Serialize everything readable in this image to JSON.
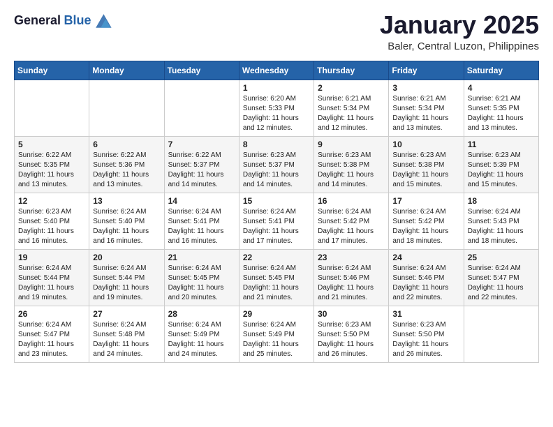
{
  "logo": {
    "line1": "General",
    "line2": "Blue"
  },
  "title": "January 2025",
  "location": "Baler, Central Luzon, Philippines",
  "weekdays": [
    "Sunday",
    "Monday",
    "Tuesday",
    "Wednesday",
    "Thursday",
    "Friday",
    "Saturday"
  ],
  "weeks": [
    [
      {
        "day": "",
        "text": ""
      },
      {
        "day": "",
        "text": ""
      },
      {
        "day": "",
        "text": ""
      },
      {
        "day": "1",
        "sunrise": "6:20 AM",
        "sunset": "5:33 PM",
        "daylight": "11 hours and 12 minutes."
      },
      {
        "day": "2",
        "sunrise": "6:21 AM",
        "sunset": "5:34 PM",
        "daylight": "11 hours and 12 minutes."
      },
      {
        "day": "3",
        "sunrise": "6:21 AM",
        "sunset": "5:34 PM",
        "daylight": "11 hours and 13 minutes."
      },
      {
        "day": "4",
        "sunrise": "6:21 AM",
        "sunset": "5:35 PM",
        "daylight": "11 hours and 13 minutes."
      }
    ],
    [
      {
        "day": "5",
        "sunrise": "6:22 AM",
        "sunset": "5:35 PM",
        "daylight": "11 hours and 13 minutes."
      },
      {
        "day": "6",
        "sunrise": "6:22 AM",
        "sunset": "5:36 PM",
        "daylight": "11 hours and 13 minutes."
      },
      {
        "day": "7",
        "sunrise": "6:22 AM",
        "sunset": "5:37 PM",
        "daylight": "11 hours and 14 minutes."
      },
      {
        "day": "8",
        "sunrise": "6:23 AM",
        "sunset": "5:37 PM",
        "daylight": "11 hours and 14 minutes."
      },
      {
        "day": "9",
        "sunrise": "6:23 AM",
        "sunset": "5:38 PM",
        "daylight": "11 hours and 14 minutes."
      },
      {
        "day": "10",
        "sunrise": "6:23 AM",
        "sunset": "5:38 PM",
        "daylight": "11 hours and 15 minutes."
      },
      {
        "day": "11",
        "sunrise": "6:23 AM",
        "sunset": "5:39 PM",
        "daylight": "11 hours and 15 minutes."
      }
    ],
    [
      {
        "day": "12",
        "sunrise": "6:23 AM",
        "sunset": "5:40 PM",
        "daylight": "11 hours and 16 minutes."
      },
      {
        "day": "13",
        "sunrise": "6:24 AM",
        "sunset": "5:40 PM",
        "daylight": "11 hours and 16 minutes."
      },
      {
        "day": "14",
        "sunrise": "6:24 AM",
        "sunset": "5:41 PM",
        "daylight": "11 hours and 16 minutes."
      },
      {
        "day": "15",
        "sunrise": "6:24 AM",
        "sunset": "5:41 PM",
        "daylight": "11 hours and 17 minutes."
      },
      {
        "day": "16",
        "sunrise": "6:24 AM",
        "sunset": "5:42 PM",
        "daylight": "11 hours and 17 minutes."
      },
      {
        "day": "17",
        "sunrise": "6:24 AM",
        "sunset": "5:42 PM",
        "daylight": "11 hours and 18 minutes."
      },
      {
        "day": "18",
        "sunrise": "6:24 AM",
        "sunset": "5:43 PM",
        "daylight": "11 hours and 18 minutes."
      }
    ],
    [
      {
        "day": "19",
        "sunrise": "6:24 AM",
        "sunset": "5:44 PM",
        "daylight": "11 hours and 19 minutes."
      },
      {
        "day": "20",
        "sunrise": "6:24 AM",
        "sunset": "5:44 PM",
        "daylight": "11 hours and 19 minutes."
      },
      {
        "day": "21",
        "sunrise": "6:24 AM",
        "sunset": "5:45 PM",
        "daylight": "11 hours and 20 minutes."
      },
      {
        "day": "22",
        "sunrise": "6:24 AM",
        "sunset": "5:45 PM",
        "daylight": "11 hours and 21 minutes."
      },
      {
        "day": "23",
        "sunrise": "6:24 AM",
        "sunset": "5:46 PM",
        "daylight": "11 hours and 21 minutes."
      },
      {
        "day": "24",
        "sunrise": "6:24 AM",
        "sunset": "5:46 PM",
        "daylight": "11 hours and 22 minutes."
      },
      {
        "day": "25",
        "sunrise": "6:24 AM",
        "sunset": "5:47 PM",
        "daylight": "11 hours and 22 minutes."
      }
    ],
    [
      {
        "day": "26",
        "sunrise": "6:24 AM",
        "sunset": "5:47 PM",
        "daylight": "11 hours and 23 minutes."
      },
      {
        "day": "27",
        "sunrise": "6:24 AM",
        "sunset": "5:48 PM",
        "daylight": "11 hours and 24 minutes."
      },
      {
        "day": "28",
        "sunrise": "6:24 AM",
        "sunset": "5:49 PM",
        "daylight": "11 hours and 24 minutes."
      },
      {
        "day": "29",
        "sunrise": "6:24 AM",
        "sunset": "5:49 PM",
        "daylight": "11 hours and 25 minutes."
      },
      {
        "day": "30",
        "sunrise": "6:23 AM",
        "sunset": "5:50 PM",
        "daylight": "11 hours and 26 minutes."
      },
      {
        "day": "31",
        "sunrise": "6:23 AM",
        "sunset": "5:50 PM",
        "daylight": "11 hours and 26 minutes."
      },
      {
        "day": "",
        "text": ""
      }
    ]
  ]
}
